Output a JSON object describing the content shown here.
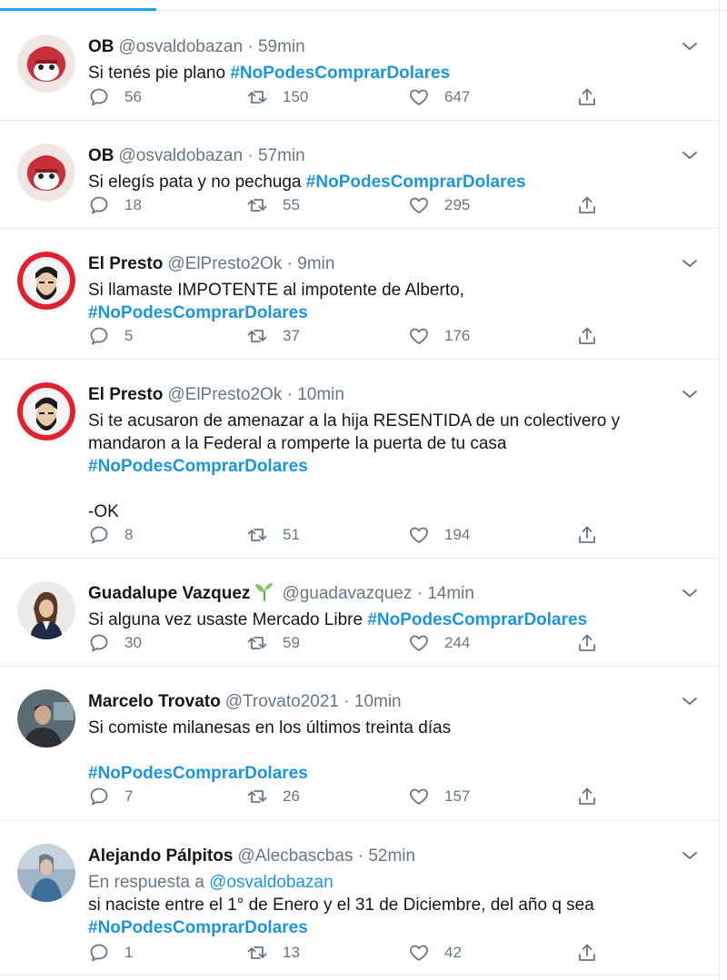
{
  "colors": {
    "link": "#1b95e0",
    "secondary_text": "#657786",
    "primary_text": "#14171a",
    "divider": "#e6ecf0",
    "tab_indicator": "#1da1f2"
  },
  "icons": {
    "reply": "reply-icon",
    "retweet": "retweet-icon",
    "like": "heart-icon",
    "share": "share-icon",
    "more": "chevron-down-icon",
    "sprout": "sprout-icon"
  },
  "tweets": [
    {
      "name": "OB",
      "handle": "@osvaldobazan",
      "separator": "·",
      "time": "59min",
      "lines": [
        [
          "Si tenés pie plano ",
          "#NoPodesComprarDolares"
        ]
      ],
      "replies": "56",
      "retweets": "150",
      "likes": "647"
    },
    {
      "name": "OB",
      "handle": "@osvaldobazan",
      "separator": "·",
      "time": "57min",
      "lines": [
        [
          "Si elegís pata y no pechuga ",
          "#NoPodesComprarDolares"
        ]
      ],
      "replies": "18",
      "retweets": "55",
      "likes": "295"
    },
    {
      "name": "El Presto",
      "handle": "@ElPresto2Ok",
      "separator": "·",
      "time": "9min",
      "lines": [
        [
          "Si llamaste IMPOTENTE al impotente de Alberto,",
          ""
        ],
        [
          "",
          "#NoPodesComprarDolares"
        ]
      ],
      "replies": "5",
      "retweets": "37",
      "likes": "176"
    },
    {
      "name": "El Presto",
      "handle": "@ElPresto2Ok",
      "separator": "·",
      "time": "10min",
      "lines": [
        [
          "Si te acusaron de amenazar a la hija RESENTIDA de un colectivero y",
          ""
        ],
        [
          "mandaron a la Federal a romperte la puerta de tu casa",
          ""
        ],
        [
          "",
          "#NoPodesComprarDolares"
        ],
        [
          "",
          ""
        ],
        [
          "-OK",
          ""
        ]
      ],
      "replies": "8",
      "retweets": "51",
      "likes": "194"
    },
    {
      "name": "Guadalupe Vazquez",
      "handle": "@guadavazquez",
      "separator": "·",
      "time": "14min",
      "lines": [
        [
          "Si alguna vez usaste Mercado Libre ",
          "#NoPodesComprarDolares"
        ]
      ],
      "replies": "30",
      "retweets": "59",
      "likes": "244"
    },
    {
      "name": "Marcelo Trovato",
      "handle": "@Trovato2021",
      "separator": "·",
      "time": "10min",
      "lines": [
        [
          "Si comiste milanesas en los últimos treinta días",
          ""
        ],
        [
          "",
          ""
        ],
        [
          "",
          "#NoPodesComprarDolares"
        ]
      ],
      "replies": "7",
      "retweets": "26",
      "likes": "157"
    },
    {
      "name": "Alejando Pálpitos",
      "handle": "@Alecbascbas",
      "separator": "·",
      "time": "52min",
      "reply_to_prefix": "En respuesta a ",
      "reply_to_handle": "@osvaldobazan",
      "lines": [
        [
          "si naciste entre el 1° de Enero y el 31 de Diciembre, del año q sea",
          ""
        ],
        [
          "",
          "#NoPodesComprarDolares"
        ]
      ],
      "replies": "1",
      "retweets": "13",
      "likes": "42"
    }
  ]
}
